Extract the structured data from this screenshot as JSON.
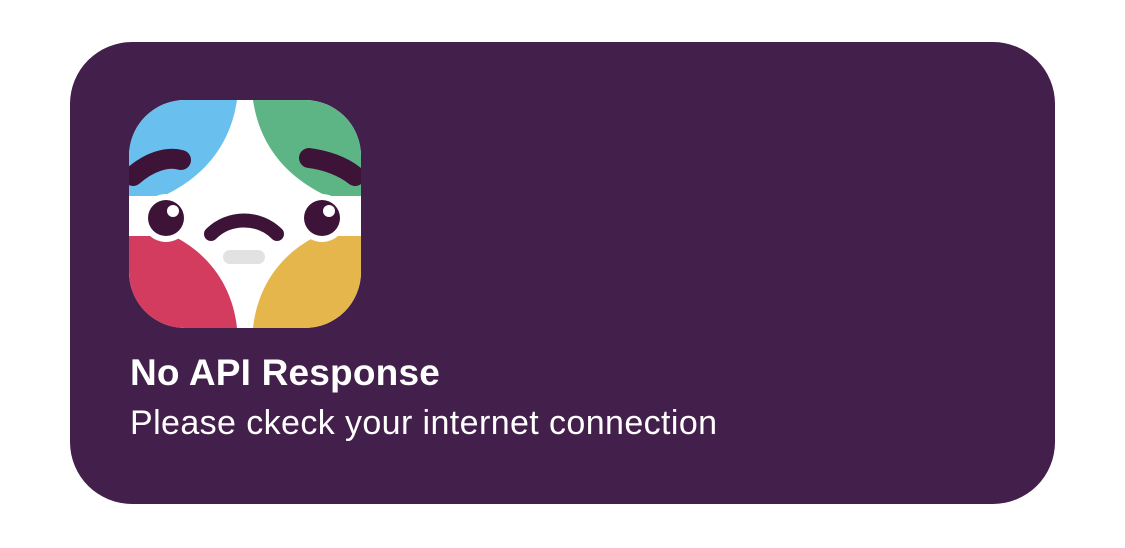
{
  "widget": {
    "icon": "sad-face-app-icon",
    "title": "No API Response",
    "message": "Please ckeck your internet connection"
  },
  "colors": {
    "widget_background": "#431f4b",
    "icon_blue": "#69c0ee",
    "icon_green": "#5db585",
    "icon_red": "#d33c5f",
    "icon_yellow": "#e5b64c",
    "face_dark": "#3d1338",
    "text": "#ffffff"
  }
}
